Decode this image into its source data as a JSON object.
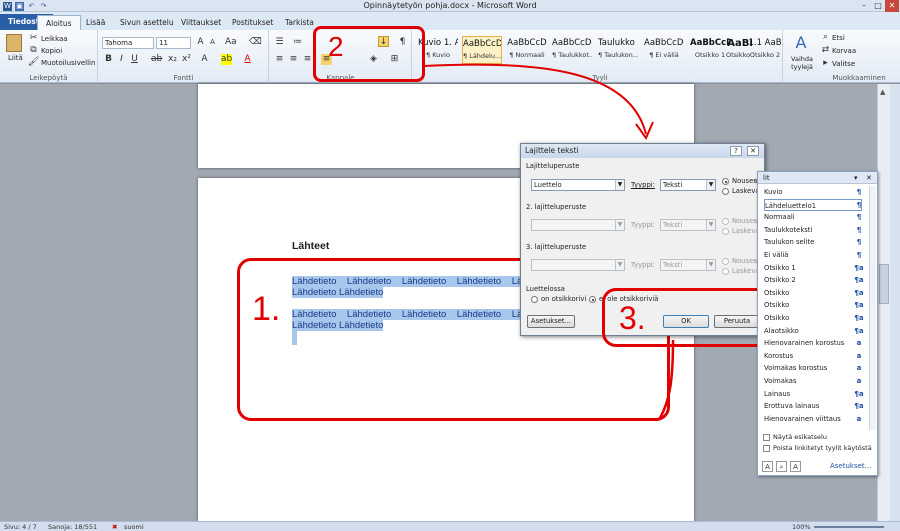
{
  "window": {
    "title": "Opinnäytetyön pohja.docx - Microsoft Word"
  },
  "tabs": [
    "Tiedosto",
    "Aloitus",
    "Lisää",
    "Sivun asettelu",
    "Viittaukset",
    "Postitukset",
    "Tarkista"
  ],
  "ribbon": {
    "clipboard": {
      "paste": "Liitä",
      "cut": "Leikkaa",
      "copy": "Kopioi",
      "format_painter": "Muotoilusivellin",
      "label": "Leikepöytä"
    },
    "font": {
      "name": "Tahoma",
      "size": "11",
      "label": "Fontti"
    },
    "paragraph": {
      "label": "Kappale"
    },
    "styles": {
      "label": "Tyyli",
      "items": [
        {
          "preview": "Kuvio 1. A",
          "label": "¶ Kuvio"
        },
        {
          "preview": "AaBbCcD",
          "label": "¶ Lähdelu..."
        },
        {
          "preview": "AaBbCcD",
          "label": "¶ Normaali"
        },
        {
          "preview": "AaBbCcDd",
          "label": "¶ Taulukkot..."
        },
        {
          "preview": "Taulukko 1",
          "label": "¶ Taulukon..."
        },
        {
          "preview": "AaBbCcDd",
          "label": "¶ Ei väliä"
        },
        {
          "preview": "AaBbCcD",
          "label": "Otsikko 1"
        },
        {
          "preview": "AaBl",
          "label": "Otsikko 1"
        },
        {
          "preview": "1.1 AaB",
          "label": "Otsikko 2"
        }
      ],
      "change": "Vaihda tyylejä"
    },
    "editing": {
      "find": "Etsi",
      "replace": "Korvaa",
      "select": "Valitse",
      "label": "Muokkaaminen"
    }
  },
  "document": {
    "heading": "Lähteet",
    "lines": [
      "Lähdetieto    Lähdetieto    Lähdetieto    Lähdetieto    Lähde",
      "Lähdetieto Lähdetieto",
      "Lähdetieto    Lähdetieto    Lähdetieto    Lähdetieto    Lähde",
      "Lähdetieto Lähdetieto"
    ]
  },
  "dialog": {
    "title": "Lajittele teksti",
    "sort_by": {
      "label": "Lajitteluperuste",
      "field": "Luettelo",
      "type_label": "Tyyppi:",
      "type": "Teksti"
    },
    "then_by": {
      "label": "2. lajitteluperuste",
      "type_label": "Tyyppi:",
      "type": "Teksti"
    },
    "then_by2": {
      "label": "3. lajitteluperuste",
      "type_label": "Tyyppi:",
      "type": "Teksti"
    },
    "ascending": "Nousева",
    "descending": "Laskeva",
    "list_label": "Luettelossa",
    "header_yes": "on otsikkorivi",
    "header_no": "ei ole otsikkoriviä",
    "options_btn": "Asetukset...",
    "ok_btn": "OK",
    "cancel_btn": "Peruuta"
  },
  "styles_pane": {
    "title": "lit",
    "items": [
      {
        "name": "Kuvio",
        "icon": "¶"
      },
      {
        "name": "Lähdeluettelo1",
        "icon": "¶"
      },
      {
        "name": "Normaali",
        "icon": "¶"
      },
      {
        "name": "Taulukkoteksti",
        "icon": "¶"
      },
      {
        "name": "Taulukon selite",
        "icon": "¶"
      },
      {
        "name": "Ei väliä",
        "icon": "¶"
      },
      {
        "name": "Otsikko 1",
        "icon": "¶a"
      },
      {
        "name": "Otsikko 2",
        "icon": "¶a"
      },
      {
        "name": "Otsikko",
        "icon": "¶a"
      },
      {
        "name": "Otsikko",
        "icon": "¶a"
      },
      {
        "name": "Otsikko",
        "icon": "¶a"
      },
      {
        "name": "Alaotsikko",
        "icon": "¶a"
      },
      {
        "name": "Hienovarainen korostus",
        "icon": "a"
      },
      {
        "name": "Korostus",
        "icon": "a"
      },
      {
        "name": "Voimakas korostus",
        "icon": "a"
      },
      {
        "name": "Voimakas",
        "icon": "a"
      },
      {
        "name": "Lainaus",
        "icon": "¶a"
      },
      {
        "name": "Erottuva lainaus",
        "icon": "¶a"
      },
      {
        "name": "Hienovarainen viittaus",
        "icon": "a"
      }
    ],
    "show_preview": "Näytä esikatselu",
    "disable_linked": "Poista linkitetyt tyylit käytöstä",
    "options": "Asetukset..."
  },
  "annotations": [
    "1.",
    "2",
    "3."
  ],
  "status": {
    "page": "Sivu: 4 / 7",
    "words": "Sanoja: 18/551",
    "lang": "suomi",
    "zoom": "100%"
  },
  "colors": {
    "accent": "#2a5ea8",
    "annotation": "#e00000",
    "selection": "#a8c7ec"
  }
}
